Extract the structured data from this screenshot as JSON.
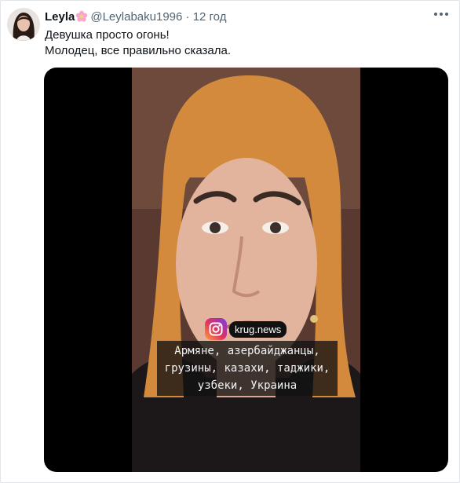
{
  "tweet": {
    "author_name": "Leyla",
    "handle": "@Leylabaku1996",
    "separator": "·",
    "time": "12 год",
    "name_emoji_icon": "cherry-blossom-icon",
    "more_icon": "more-horizontal-icon",
    "text_lines": [
      "Девушка просто огонь!",
      "Молодец, все правильно сказала."
    ]
  },
  "media": {
    "type": "video-screenshot",
    "badge": {
      "icon": "instagram-icon",
      "label": "krug.news"
    },
    "caption_lines": [
      "Армяне, азербайджанцы,",
      "грузины, казахи, таджики,",
      "узбеки, Украина"
    ]
  },
  "colors": {
    "text": "#0f1419",
    "muted": "#536471",
    "media_background": "#000000",
    "caption_background": "#121212"
  }
}
